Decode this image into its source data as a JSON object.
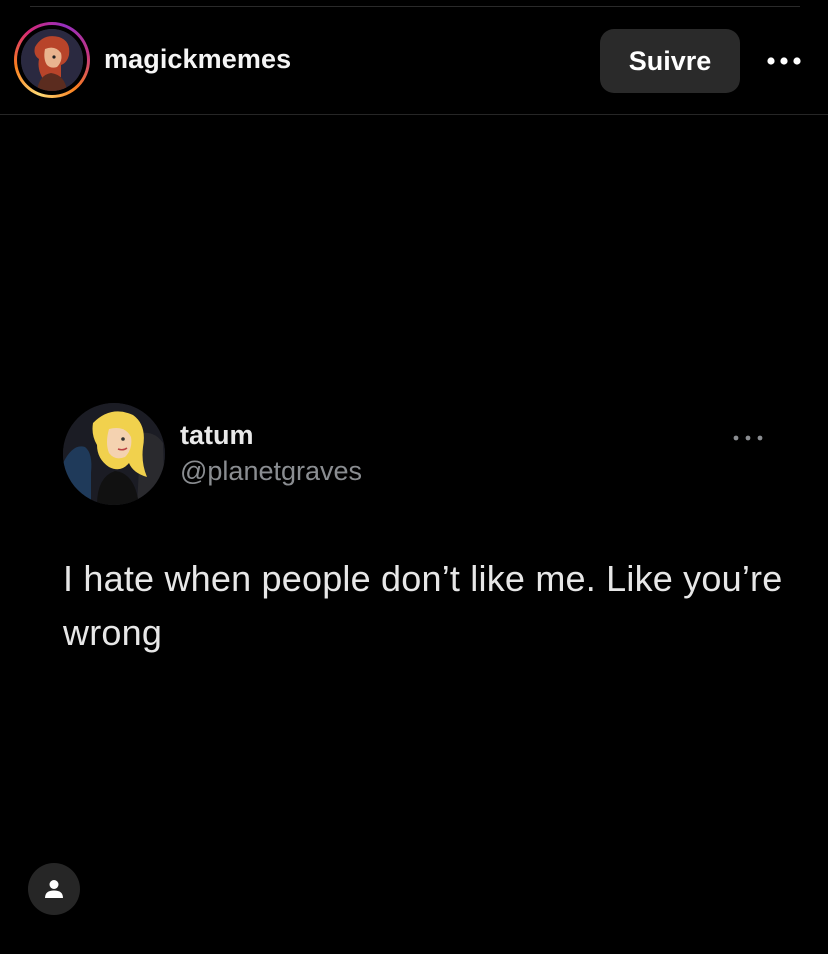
{
  "post": {
    "author_username": "magickmemes",
    "follow_label": "Suivre",
    "more_icon": "more-horizontal-icon"
  },
  "tweet": {
    "display_name": "tatum",
    "handle": "@planetgraves",
    "text": "I hate when people don’t like me. Like you’re wrong",
    "more_icon": "more-horizontal-icon"
  },
  "tags": {
    "icon": "person-icon"
  },
  "colors": {
    "background": "#000000",
    "button_bg": "#2a2a2a",
    "handle_gray": "#8a8d91",
    "story_ring": [
      "#feda75",
      "#fa7e1e",
      "#d62976",
      "#962fbf"
    ]
  }
}
